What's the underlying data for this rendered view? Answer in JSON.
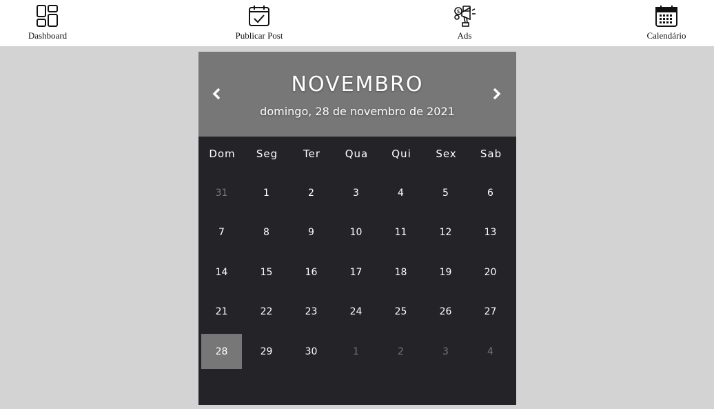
{
  "nav": {
    "items": [
      {
        "label": "Dashboard",
        "icon": "dashboard-grid-icon"
      },
      {
        "label": "Publicar Post",
        "icon": "calendar-check-icon"
      },
      {
        "label": "Ads",
        "icon": "megaphone-icon"
      },
      {
        "label": "Calendário",
        "icon": "calendar-icon"
      }
    ]
  },
  "calendar": {
    "month": "NOVEMBRO",
    "full_date": "domingo, 28 de novembro de 2021",
    "prev_icon": "chevron-left-icon",
    "next_icon": "chevron-right-icon",
    "weekdays": [
      "Dom",
      "Seg",
      "Ter",
      "Qua",
      "Qui",
      "Sex",
      "Sab"
    ],
    "weeks": [
      [
        "31",
        "1",
        "2",
        "3",
        "4",
        "5",
        "6"
      ],
      [
        "7",
        "8",
        "9",
        "10",
        "11",
        "12",
        "13"
      ],
      [
        "14",
        "15",
        "16",
        "17",
        "18",
        "19",
        "20"
      ],
      [
        "21",
        "22",
        "23",
        "24",
        "25",
        "26",
        "27"
      ],
      [
        "28",
        "29",
        "30",
        "1",
        "2",
        "3",
        "4"
      ]
    ],
    "muted_days": [
      [
        0,
        0
      ],
      [
        4,
        3
      ],
      [
        4,
        4
      ],
      [
        4,
        5
      ],
      [
        4,
        6
      ]
    ],
    "selected_day": [
      4,
      0
    ],
    "colors": {
      "page_bg": "#d3d3d3",
      "header_bg": "#777777",
      "body_bg": "#242327",
      "selected_bg": "#777777",
      "muted_text": "#77767a"
    }
  }
}
